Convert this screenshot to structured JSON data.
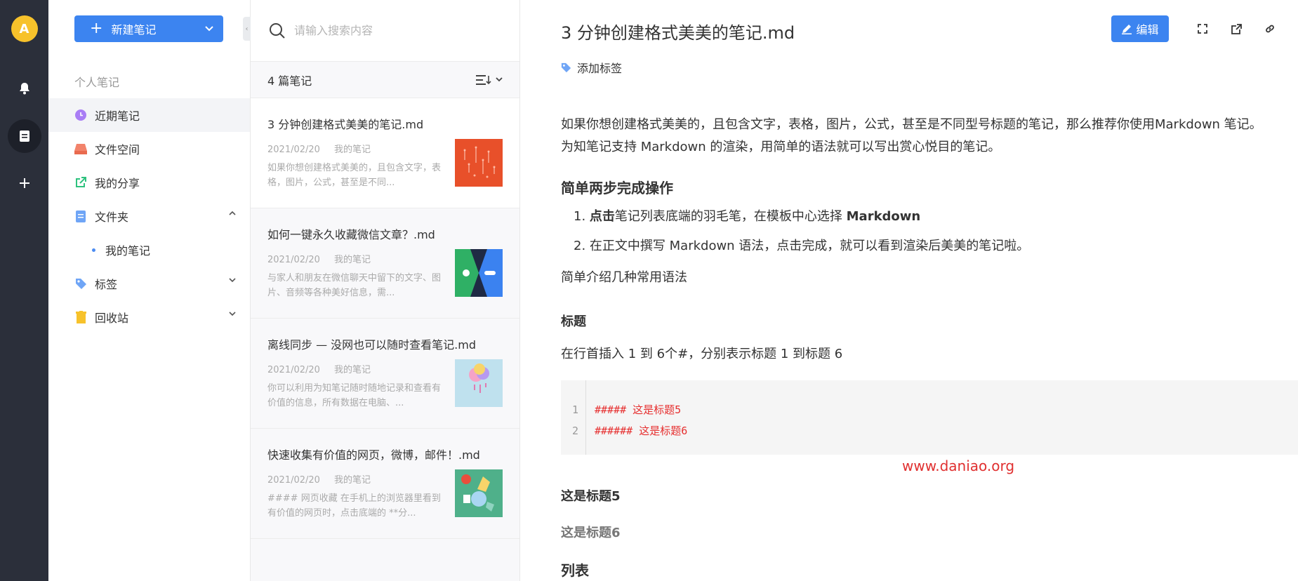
{
  "user": {
    "avatar_letter": "A"
  },
  "sidebar": {
    "new_note_label": "新建笔记",
    "section_title": "个人笔记",
    "items": [
      {
        "label": "近期笔记",
        "icon": "clock-icon",
        "color": "#a97df5"
      },
      {
        "label": "文件空间",
        "icon": "inbox-icon",
        "color": "#f2836b"
      },
      {
        "label": "我的分享",
        "icon": "share-icon",
        "color": "#2ec27e"
      },
      {
        "label": "文件夹",
        "icon": "folder-icon",
        "color": "#6fa5f6"
      },
      {
        "label": "我的笔记",
        "icon": "dot-icon",
        "color": "#4c8cf2"
      },
      {
        "label": "标签",
        "icon": "tag-icon",
        "color": "#6fa5f6"
      },
      {
        "label": "回收站",
        "icon": "trash-icon",
        "color": "#f7c22b"
      }
    ]
  },
  "list": {
    "search_placeholder": "请输入搜索内容",
    "count_label": "4 篇笔记",
    "notes": [
      {
        "title": "3 分钟创建格式美美的笔记.md",
        "date": "2021/02/20",
        "folder": "我的笔记",
        "excerpt": "如果你想创建格式美美的，且包含文字，表格，图片，公式，甚至是不同..."
      },
      {
        "title": "如何一键永久收藏微信文章？.md",
        "date": "2021/02/20",
        "folder": "我的笔记",
        "excerpt": "与家人和朋友在微信聊天中留下的文字、图片、音频等各种美好信息，需..."
      },
      {
        "title": "离线同步 — 没网也可以随时查看笔记.md",
        "date": "2021/02/20",
        "folder": "我的笔记",
        "excerpt": "你可以利用为知笔记随时随地记录和查看有价值的信息，所有数据在电脑、..."
      },
      {
        "title": "快速收集有价值的网页，微博，邮件！.md",
        "date": "2021/02/20",
        "folder": "我的笔记",
        "excerpt": "#### 网页收藏 在手机上的浏览器里看到有价值的网页时，点击底端的 **分..."
      }
    ]
  },
  "doc": {
    "title": "3 分钟创建格式美美的笔记.md",
    "edit_label": "编辑",
    "add_tag_label": "添加标签",
    "intro_line1": "如果你想创建格式美美的，且包含文字，表格，图片，公式，甚至是不同型号标题的笔记，那么推荐你使用Markdown 笔记。",
    "intro_line2": "为知笔记支持 Markdown 的渲染，用简单的语法就可以写出赏心悦目的笔记。",
    "h_steps": "简单两步完成操作",
    "step1_bold": "点击",
    "step1_text": "笔记列表底端的羽毛笔，在模板中心选择 ",
    "step1_bold2": "Markdown",
    "step2_text": "在正文中撰写 Markdown 语法，点击完成，就可以看到渲染后美美的笔记啦。",
    "intro_syntax": "简单介绍几种常用语法",
    "h_title": "标题",
    "title_desc": "在行首插入 1 到 6个#，分别表示标题 1 到标题 6",
    "code_lines": [
      "##### 这是标题5",
      "###### 这是标题6"
    ],
    "code_numbers": [
      "1",
      "2"
    ],
    "watermark": "www.daniao.org",
    "demo_h5": "这是标题5",
    "demo_h6": "这是标题6",
    "h_list": "列表"
  }
}
